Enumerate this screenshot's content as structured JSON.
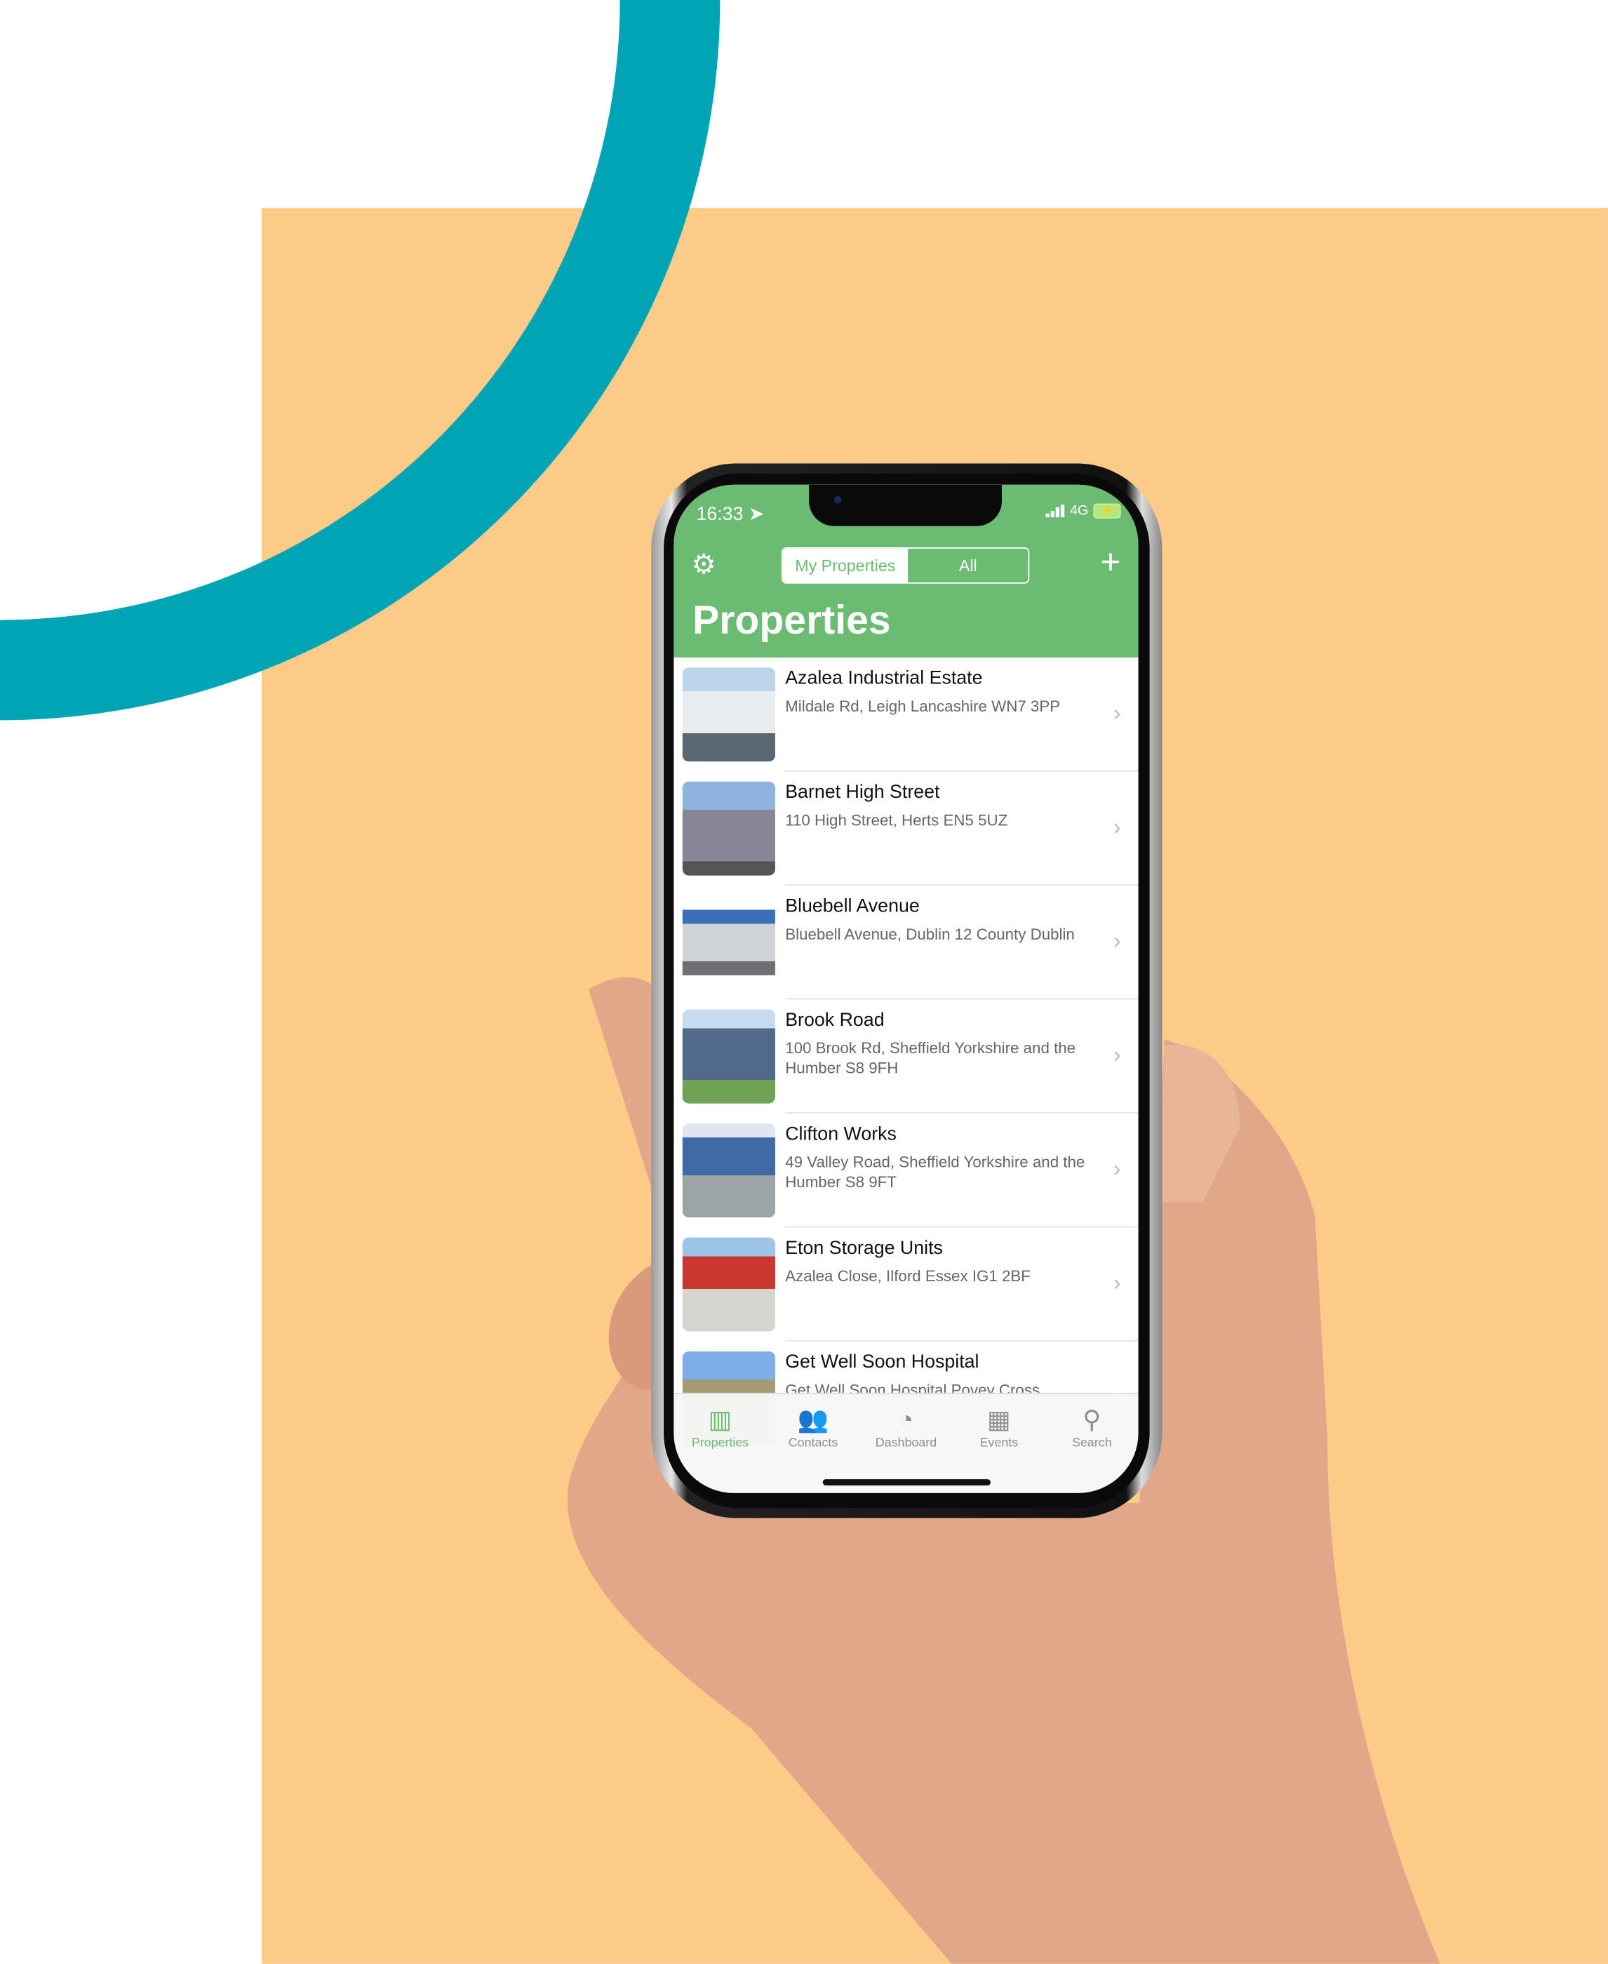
{
  "colors": {
    "accent": "#6cbb73",
    "background": "#fccb88",
    "ring": "#00a5b5"
  },
  "status": {
    "time": "16:33",
    "network": "4G"
  },
  "header": {
    "settings_icon": "gear-icon",
    "segments": [
      "My Properties",
      "All"
    ],
    "selected_segment": "My Properties",
    "add_icon": "plus-icon",
    "title": "Properties"
  },
  "properties": [
    {
      "name": "Azalea Industrial Estate",
      "address": "Mildale Rd, Leigh Lancashire WN7 3PP"
    },
    {
      "name": "Barnet High Street",
      "address": "110 High Street, Herts EN5 5UZ"
    },
    {
      "name": "Bluebell Avenue",
      "address": "Bluebell Avenue, Dublin 12 County Dublin"
    },
    {
      "name": "Brook Road",
      "address": "100 Brook Rd, Sheffield Yorkshire and the Humber S8 9FH"
    },
    {
      "name": "Clifton Works",
      "address": "49 Valley Road, Sheffield Yorkshire and the Humber S8 9FT"
    },
    {
      "name": "Eton Storage Units",
      "address": "Azalea Close, Ilford Essex IG1 2BF"
    },
    {
      "name": "Get Well Soon Hospital",
      "address": "Get Well Soon Hospital Povey Cross"
    }
  ],
  "tabs": [
    {
      "label": "Properties",
      "icon": "building-icon",
      "active": true
    },
    {
      "label": "Contacts",
      "icon": "contacts-icon"
    },
    {
      "label": "Dashboard",
      "icon": "gauge-icon"
    },
    {
      "label": "Events",
      "icon": "calendar-clock-icon"
    },
    {
      "label": "Search",
      "icon": "search-icon"
    }
  ]
}
